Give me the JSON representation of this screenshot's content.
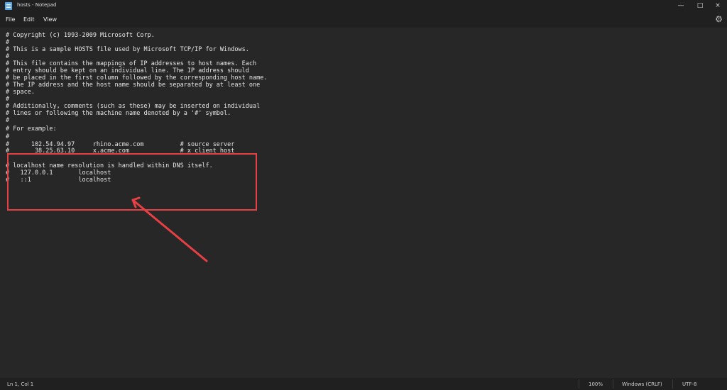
{
  "window": {
    "title": "hosts - Notepad",
    "controls": {
      "minimize": "—",
      "maximize": "□",
      "close": "×"
    }
  },
  "menu": {
    "file": "File",
    "edit": "Edit",
    "view": "View"
  },
  "editor": {
    "lines": [
      "# Copyright (c) 1993-2009 Microsoft Corp.",
      "#",
      "# This is a sample HOSTS file used by Microsoft TCP/IP for Windows.",
      "#",
      "# This file contains the mappings of IP addresses to host names. Each",
      "# entry should be kept on an individual line. The IP address should",
      "# be placed in the first column followed by the corresponding host name.",
      "# The IP address and the host name should be separated by at least one",
      "# space.",
      "#",
      "# Additionally, comments (such as these) may be inserted on individual",
      "# lines or following the machine name denoted by a '#' symbol.",
      "#",
      "# For example:",
      "#",
      "#      102.54.94.97     rhino.acme.com          # source server",
      "#       38.25.63.10     x.acme.com              # x client host",
      "",
      "# localhost name resolution is handled within DNS itself.",
      "#   127.0.0.1       localhost",
      "#   ::1             localhost"
    ]
  },
  "status": {
    "position": "Ln 1, Col 1",
    "zoom": "100%",
    "line_ending": "Windows (CRLF)",
    "encoding": "UTF-8"
  },
  "colors": {
    "background": "#272727",
    "chrome": "#202020",
    "text": "#e7e7e7",
    "annotation": "#e63f44"
  },
  "icons": {
    "app": "notepad-icon",
    "settings": "gear-icon",
    "annotation": "red-arrow-icon"
  }
}
